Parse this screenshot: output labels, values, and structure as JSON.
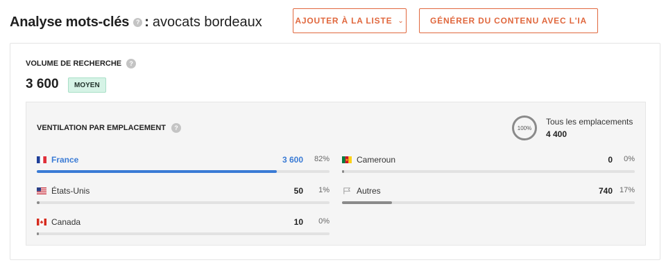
{
  "header": {
    "title": "Analyse mots-clés",
    "colon": ":",
    "keyword": "avocats bordeaux",
    "help": "?"
  },
  "actions": {
    "add_to_list": "AJOUTER À LA LISTE",
    "generate_ai": "GÉNÉRER DU CONTENU AVEC L'IA"
  },
  "volume": {
    "label": "VOLUME DE RECHERCHE",
    "value": "3 600",
    "badge": "MOYEN"
  },
  "breakdown": {
    "title": "VENTILATION PAR EMPLACEMENT",
    "circle_label": "100%",
    "all_locations_label": "Tous les emplacements",
    "all_locations_value": "4 400",
    "colors": {
      "active": "#3a7bd5",
      "other": "#8a8a8a",
      "track": "#e2e2e2"
    },
    "locations": [
      {
        "name": "France",
        "value": "3 600",
        "percent": "82%",
        "share": 0.82,
        "flag": "flag-france",
        "active": true
      },
      {
        "name": "États-Unis",
        "value": "50",
        "percent": "1%",
        "share": 0.01,
        "flag": "flag-usa",
        "active": false
      },
      {
        "name": "Canada",
        "value": "10",
        "percent": "0%",
        "share": 0.0,
        "flag": "flag-canada",
        "active": false
      },
      {
        "name": "Cameroun",
        "value": "0",
        "percent": "0%",
        "share": 0.0,
        "flag": "flag-cameroon",
        "active": false
      },
      {
        "name": "Autres",
        "value": "740",
        "percent": "17%",
        "share": 0.17,
        "flag": "flag-outline",
        "active": false
      }
    ]
  }
}
